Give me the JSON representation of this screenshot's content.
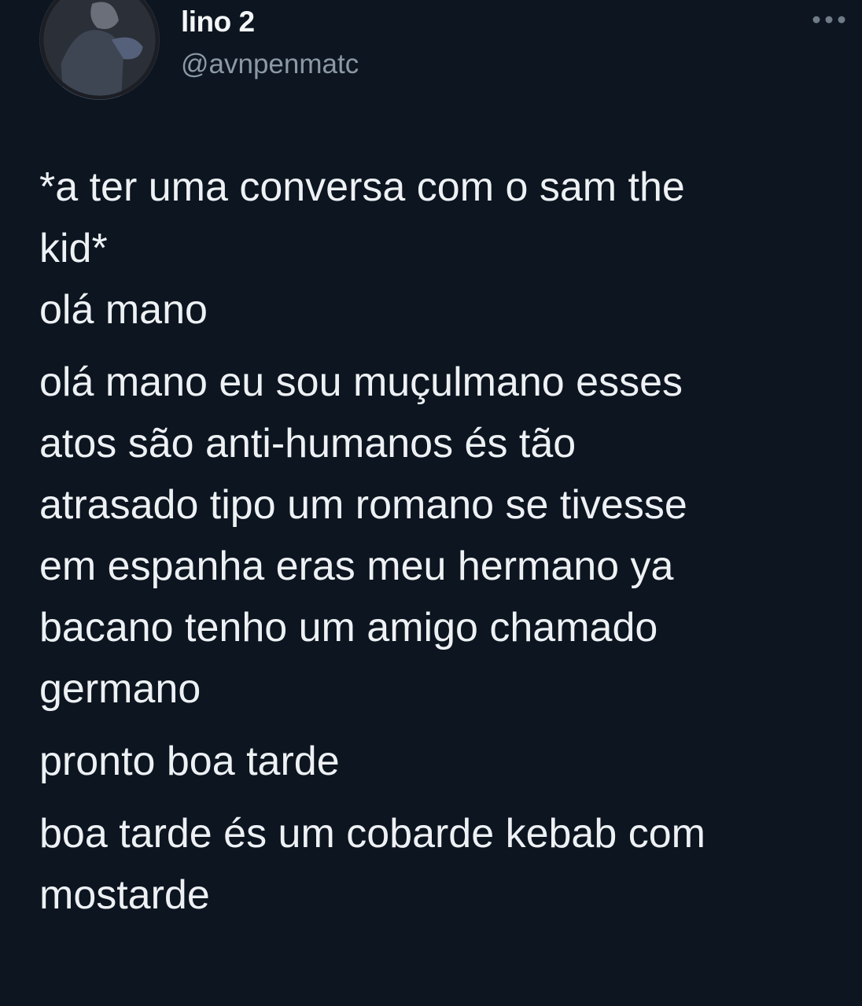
{
  "header": {
    "display_name": "lino 2",
    "handle": "@avnpenmatc",
    "avatar_icon": "avatar-photo",
    "more_icon": "more-options-icon"
  },
  "tweet": {
    "paragraphs": [
      "*a ter uma conversa com o sam the kid*\nolá mano",
      "olá mano eu sou muçulmano esses atos são anti-humanos és tão atrasado tipo um romano se tivesse em espanha eras meu hermano ya bacano tenho um amigo chamado germano",
      "pronto boa tarde",
      "boa tarde és um cobarde kebab com mostarde"
    ]
  },
  "colors": {
    "background": "#0c1520",
    "text_primary": "#eef1f4",
    "text_secondary": "#8b98a5"
  }
}
